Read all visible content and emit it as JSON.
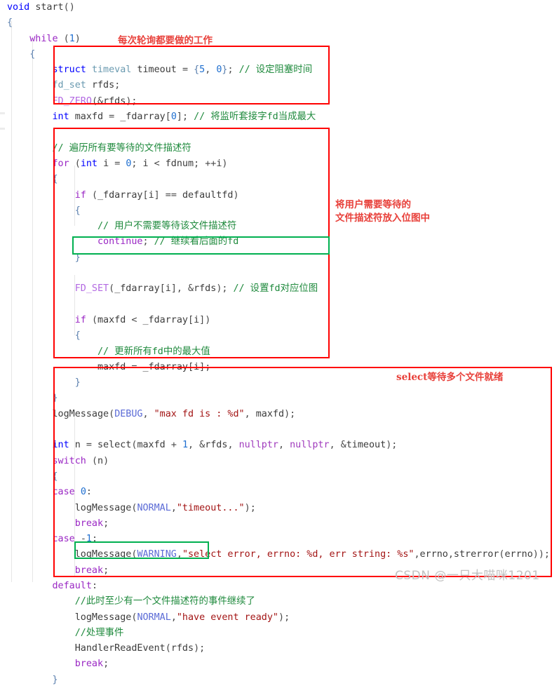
{
  "watermark": "CSDN @一只大喵咪1201",
  "annotations": {
    "poll_work": "每次轮询都要做的工作",
    "bitmap_note": "将用户需要等待的\n文件描述符放入位图中",
    "select_note": "select等待多个文件就绪"
  },
  "code_lines": [
    {
      "id": "l01",
      "text": "void start()"
    },
    {
      "id": "l02",
      "text": "{"
    },
    {
      "id": "l03",
      "text": "    while (1)"
    },
    {
      "id": "l04",
      "text": "    {"
    },
    {
      "id": "l05",
      "text": "        struct timeval timeout = {5, 0}; // 设定阻塞时间"
    },
    {
      "id": "l06",
      "text": "        fd_set rfds;"
    },
    {
      "id": "l07",
      "text": "        FD_ZERO(&rfds);"
    },
    {
      "id": "l08",
      "text": "        int maxfd = _fdarray[0]; // 将监听套接字fd当成最大"
    },
    {
      "id": "l09",
      "text": ""
    },
    {
      "id": "l10",
      "text": "        // 遍历所有要等待的文件描述符"
    },
    {
      "id": "l11",
      "text": "        for (int i = 0; i < fdnum; ++i)"
    },
    {
      "id": "l12",
      "text": "        {"
    },
    {
      "id": "l13",
      "text": "            if (_fdarray[i] == defaultfd)"
    },
    {
      "id": "l14",
      "text": "            {"
    },
    {
      "id": "l15",
      "text": "                // 用户不需要等待该文件描述符"
    },
    {
      "id": "l16",
      "text": "                continue; // 继续看后面的fd"
    },
    {
      "id": "l17",
      "text": "            }"
    },
    {
      "id": "l18",
      "text": ""
    },
    {
      "id": "l19",
      "text": "            FD_SET(_fdarray[i], &rfds); // 设置fd对应位图"
    },
    {
      "id": "l20",
      "text": ""
    },
    {
      "id": "l21",
      "text": "            if (maxfd < _fdarray[i])"
    },
    {
      "id": "l22",
      "text": "            {"
    },
    {
      "id": "l23",
      "text": "                // 更新所有fd中的最大值"
    },
    {
      "id": "l24",
      "text": "                maxfd = _fdarray[i];"
    },
    {
      "id": "l25",
      "text": "            }"
    },
    {
      "id": "l26",
      "text": "        }"
    },
    {
      "id": "l27",
      "text": "        logMessage(DEBUG, \"max fd is : %d\", maxfd);"
    },
    {
      "id": "l28",
      "text": ""
    },
    {
      "id": "l29",
      "text": "        int n = select(maxfd + 1, &rfds, nullptr, nullptr, &timeout);"
    },
    {
      "id": "l30",
      "text": "        switch (n)"
    },
    {
      "id": "l31",
      "text": "        {"
    },
    {
      "id": "l32",
      "text": "        case 0:"
    },
    {
      "id": "l33",
      "text": "            logMessage(NORMAL,\"timeout...\");"
    },
    {
      "id": "l34",
      "text": "            break;"
    },
    {
      "id": "l35",
      "text": "        case -1:"
    },
    {
      "id": "l36",
      "text": "            logMessage(WARNING,\"select error, errno: %d, err string: %s\",errno,strerror(errno));"
    },
    {
      "id": "l37",
      "text": "            break;"
    },
    {
      "id": "l38",
      "text": "        default:"
    },
    {
      "id": "l39",
      "text": "            //此时至少有一个文件描述符的事件继续了"
    },
    {
      "id": "l40",
      "text": "            logMessage(NORMAL,\"have event ready\");"
    },
    {
      "id": "l41",
      "text": "            //处理事件"
    },
    {
      "id": "l42",
      "text": "            HandlerReadEvent(rfds);"
    },
    {
      "id": "l43",
      "text": "            break;"
    },
    {
      "id": "l44",
      "text": "        }"
    }
  ],
  "colors": {
    "highlight_red": "#ff0000",
    "highlight_green": "#00b050",
    "annotation_red": "#e8403a",
    "keyword_blue": "#0000ff",
    "keyword_purple": "#9a27c4",
    "comment_green": "#1f8a3d",
    "string_red": "#a31515",
    "macro_purple": "#b36ae2",
    "watermark_gray": "#c2c2c2",
    "background": "#ffffff"
  }
}
